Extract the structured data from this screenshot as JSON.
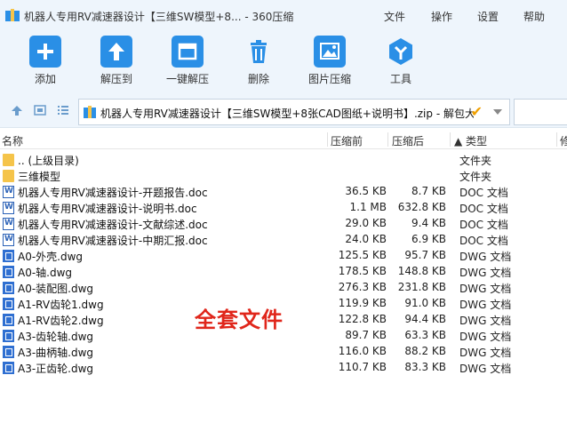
{
  "window": {
    "title": "机器人专用RV减速器设计【三维SW模型+8... - 360压缩",
    "menu": [
      "文件",
      "操作",
      "设置",
      "帮助"
    ]
  },
  "toolbar": {
    "buttons": [
      {
        "label": "添加",
        "icon": "add-icon"
      },
      {
        "label": "解压到",
        "icon": "extract-to-icon"
      },
      {
        "label": "一键解压",
        "icon": "one-click-extract-icon"
      },
      {
        "label": "删除",
        "icon": "delete-icon"
      },
      {
        "label": "图片压缩",
        "icon": "image-compress-icon"
      },
      {
        "label": "工具",
        "icon": "tools-icon"
      }
    ]
  },
  "address": {
    "path": "机器人专用RV减速器设计【三维SW模型+8张CAD图纸+说明书】.zip - 解包大",
    "check_glyph": "✔"
  },
  "columns": {
    "name": "名称",
    "size": "压缩前",
    "compressed": "压缩后",
    "type": "▲ 类型",
    "extra": "修"
  },
  "files": [
    {
      "name": ".. (上级目录)",
      "size": "",
      "compressed": "",
      "type": "文件夹",
      "kind": "folder"
    },
    {
      "name": "三维模型",
      "size": "",
      "compressed": "",
      "type": "文件夹",
      "kind": "folder"
    },
    {
      "name": "机器人专用RV减速器设计-开题报告.doc",
      "size": "36.5 KB",
      "compressed": "8.7 KB",
      "type": "DOC 文档",
      "kind": "doc"
    },
    {
      "name": "机器人专用RV减速器设计-说明书.doc",
      "size": "1.1 MB",
      "compressed": "632.8 KB",
      "type": "DOC 文档",
      "kind": "doc"
    },
    {
      "name": "机器人专用RV减速器设计-文献综述.doc",
      "size": "29.0 KB",
      "compressed": "9.4 KB",
      "type": "DOC 文档",
      "kind": "doc"
    },
    {
      "name": "机器人专用RV减速器设计-中期汇报.doc",
      "size": "24.0 KB",
      "compressed": "6.9 KB",
      "type": "DOC 文档",
      "kind": "doc"
    },
    {
      "name": "A0-外壳.dwg",
      "size": "125.5 KB",
      "compressed": "95.7 KB",
      "type": "DWG 文档",
      "kind": "dwg"
    },
    {
      "name": "A0-轴.dwg",
      "size": "178.5 KB",
      "compressed": "148.8 KB",
      "type": "DWG 文档",
      "kind": "dwg"
    },
    {
      "name": "A0-装配图.dwg",
      "size": "276.3 KB",
      "compressed": "231.8 KB",
      "type": "DWG 文档",
      "kind": "dwg"
    },
    {
      "name": "A1-RV齿轮1.dwg",
      "size": "119.9 KB",
      "compressed": "91.0 KB",
      "type": "DWG 文档",
      "kind": "dwg"
    },
    {
      "name": "A1-RV齿轮2.dwg",
      "size": "122.8 KB",
      "compressed": "94.4 KB",
      "type": "DWG 文档",
      "kind": "dwg"
    },
    {
      "name": "A3-齿轮轴.dwg",
      "size": "89.7 KB",
      "compressed": "63.3 KB",
      "type": "DWG 文档",
      "kind": "dwg"
    },
    {
      "name": "A3-曲柄轴.dwg",
      "size": "116.0 KB",
      "compressed": "88.2 KB",
      "type": "DWG 文档",
      "kind": "dwg"
    },
    {
      "name": "A3-正齿轮.dwg",
      "size": "110.7 KB",
      "compressed": "83.3 KB",
      "type": "DWG 文档",
      "kind": "dwg"
    }
  ],
  "overlay_text": "全套文件",
  "colors": {
    "accent": "#2a8fe6",
    "overlay": "#e0261b",
    "folder": "#f5c44a"
  }
}
